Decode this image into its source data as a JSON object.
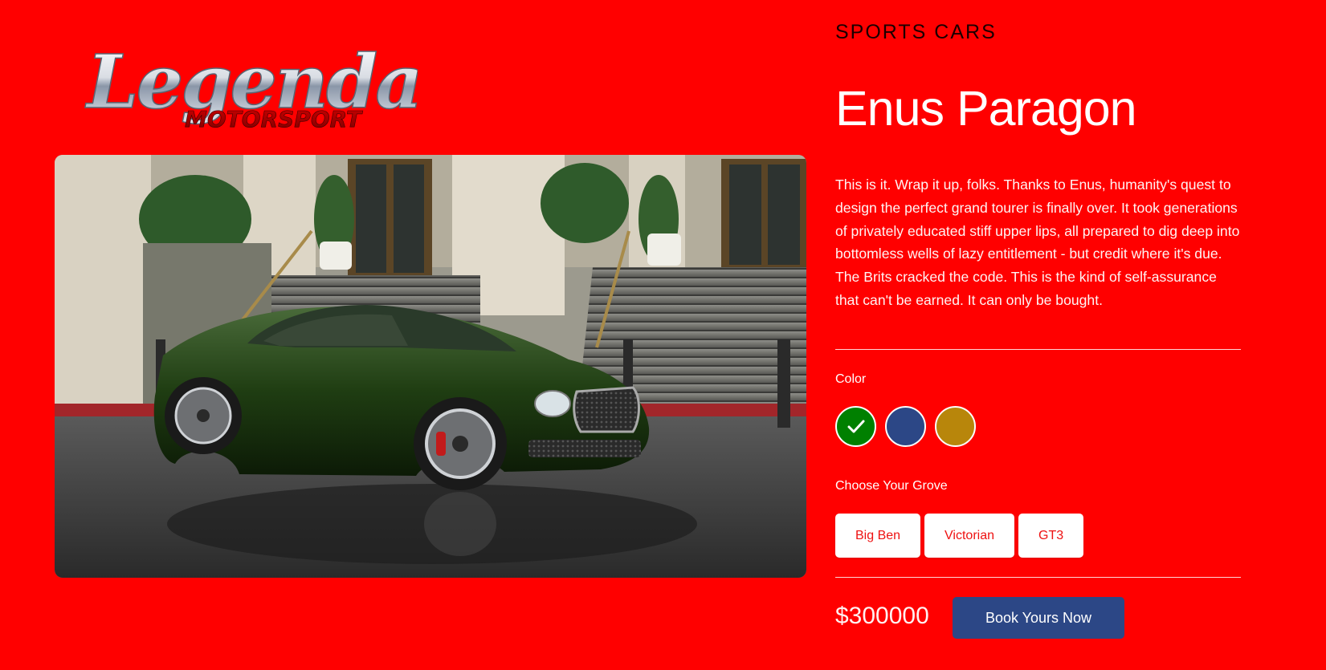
{
  "logo": {
    "script_text": "Legendary",
    "sub_text": "MOTORSPORT"
  },
  "product": {
    "category": "SPORTS CARS",
    "name": "Enus Paragon",
    "description": "This is it. Wrap it up, folks. Thanks to Enus, humanity's quest to design the perfect grand tourer is finally over. It took generations of privately educated stiff upper lips, all prepared to dig deep into bottomless wells of lazy entitlement - but credit where it's due. The Brits cracked the code. This is the kind of self-assurance that can't be earned. It can only be bought.",
    "image_icon": "car-photo"
  },
  "color_section": {
    "label": "Color",
    "options": [
      {
        "color": "#008000",
        "selected": true,
        "icon": "check-icon"
      },
      {
        "color": "#2c4786",
        "selected": false
      },
      {
        "color": "#b8860b",
        "selected": false
      }
    ]
  },
  "grove_section": {
    "label": "Choose Your Grove",
    "options": [
      "Big Ben",
      "Victorian",
      "GT3"
    ]
  },
  "purchase": {
    "price": "$300000",
    "cta_label": "Book Yours Now"
  },
  "theme": {
    "background": "#ff0000",
    "accent": "#2c4786"
  }
}
